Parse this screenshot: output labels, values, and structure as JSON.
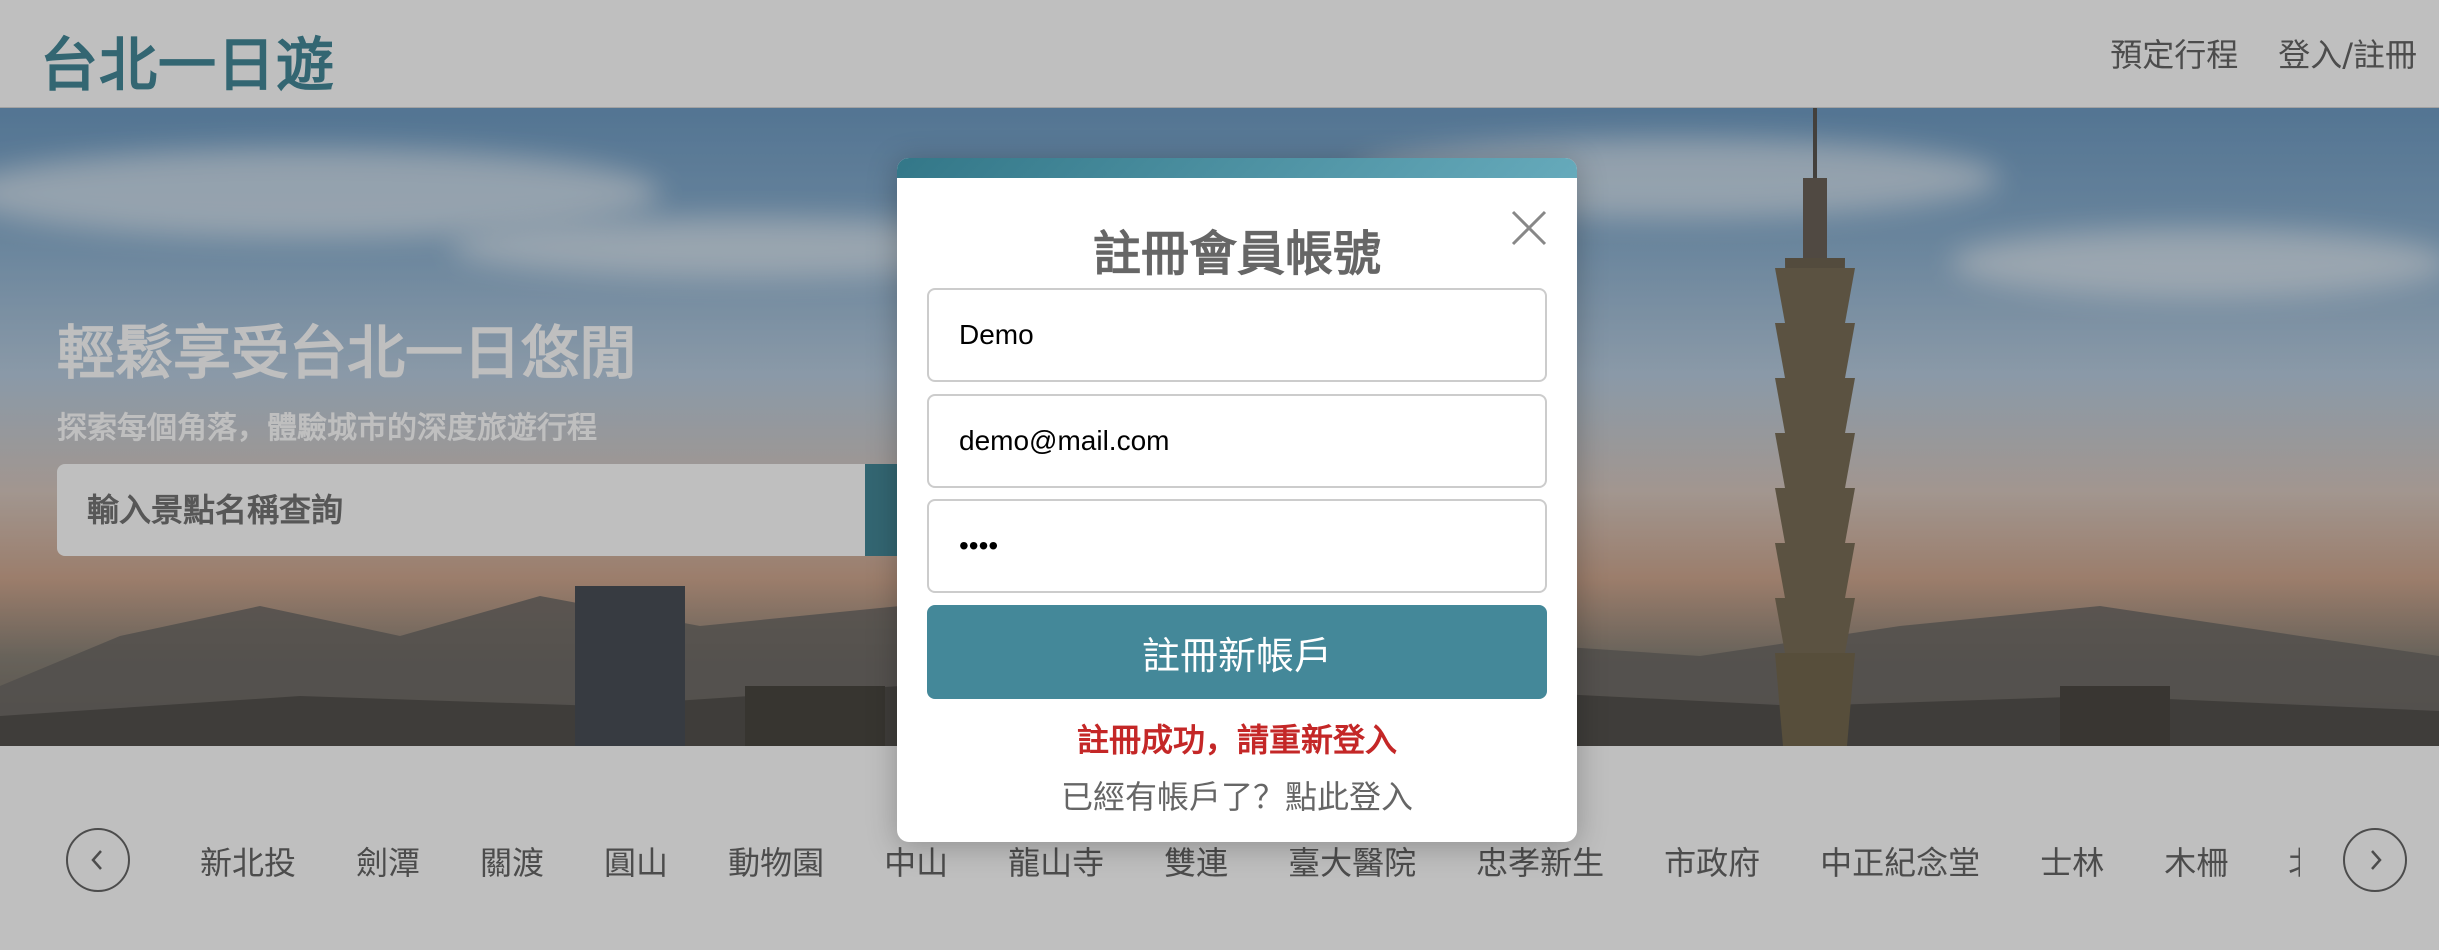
{
  "header": {
    "brand": "台北一日遊",
    "nav": [
      "預定行程",
      "登入/註冊"
    ]
  },
  "hero": {
    "title": "輕鬆享受台北一日悠閒",
    "subtitle": "探索每個角落，體驗城市的深度旅遊行程",
    "search_placeholder": "輸入景點名稱查詢"
  },
  "mrt": {
    "stations": [
      "新北投",
      "劍潭",
      "關渡",
      "圓山",
      "動物園",
      "中山",
      "龍山寺",
      "雙連",
      "臺大醫院",
      "忠孝新生",
      "市政府",
      "中正紀念堂",
      "士林",
      "木柵",
      "北投"
    ]
  },
  "modal": {
    "title": "註冊會員帳號",
    "name_value": "Demo",
    "email_value": "demo@mail.com",
    "password_value": "demo",
    "submit_label": "註冊新帳戶",
    "message": "註冊成功，請重新登入",
    "switch_label": "已經有帳戶了？點此登入"
  },
  "colors": {
    "accent": "#448899",
    "error": "#c42727",
    "text_gray": "#666666"
  }
}
